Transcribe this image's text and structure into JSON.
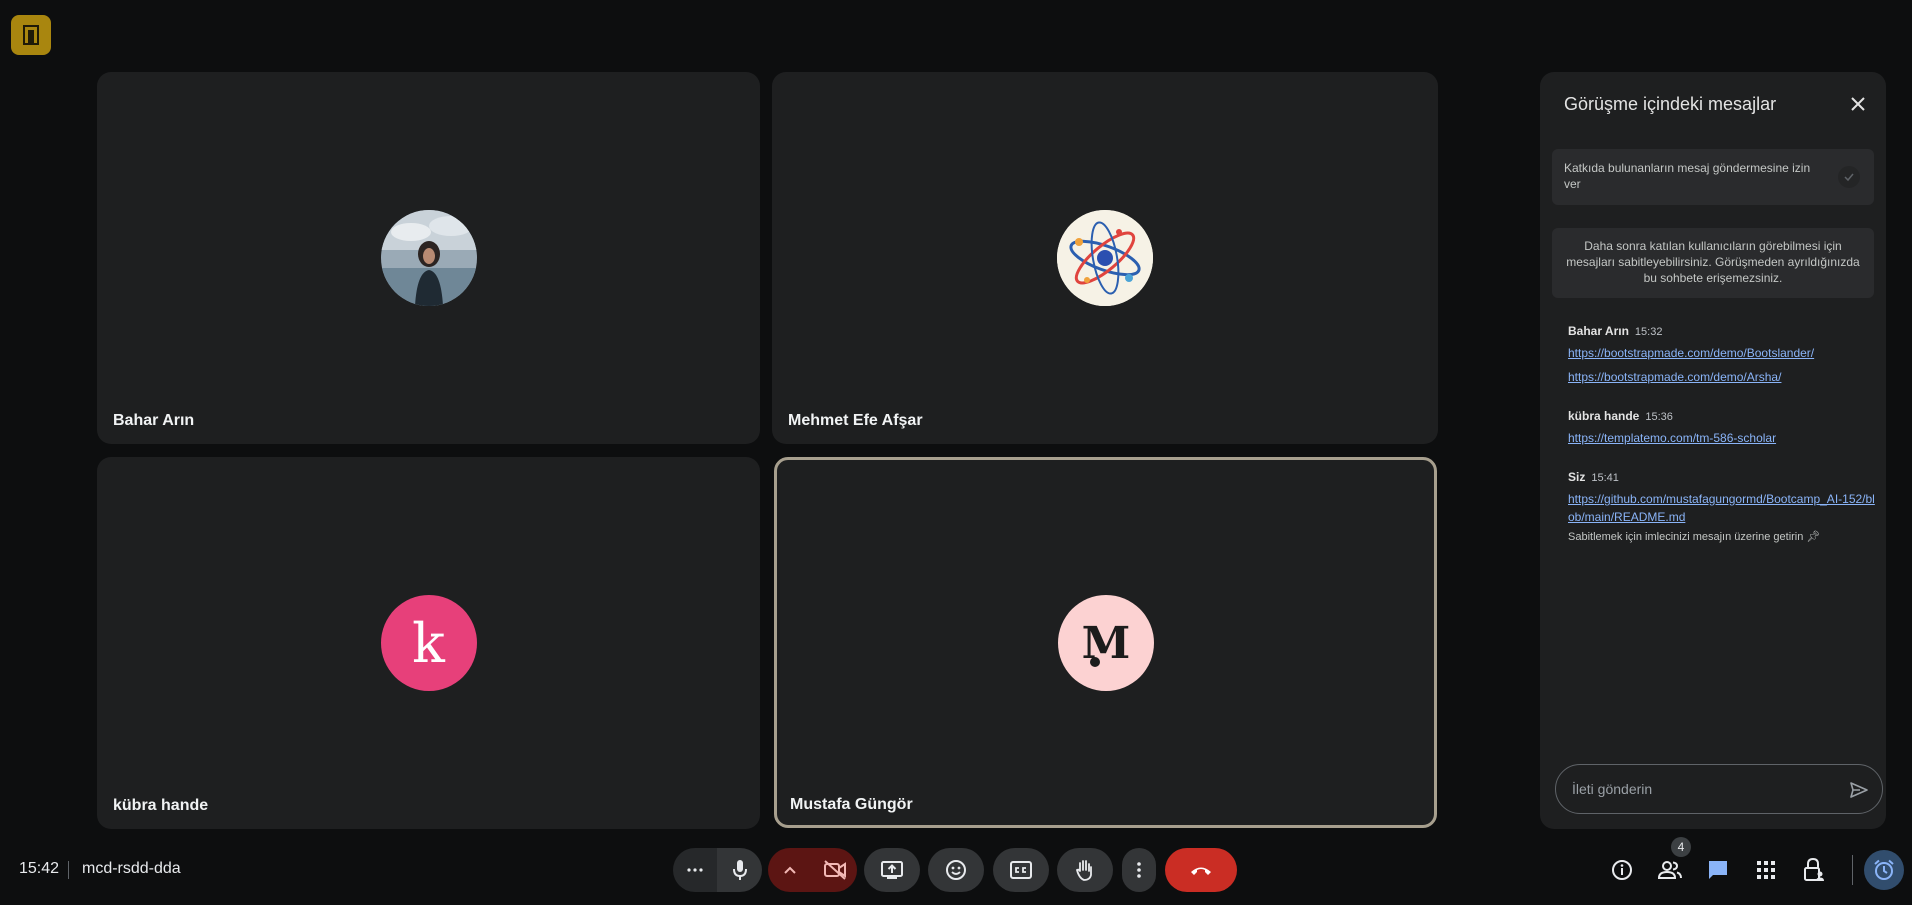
{
  "participants": [
    {
      "name": "Bahar Arın"
    },
    {
      "name": "Mehmet Efe Afşar"
    },
    {
      "name": "kübra hande",
      "initial": "k"
    },
    {
      "name": "Mustafa Güngör",
      "initial": "M"
    }
  ],
  "panel": {
    "title": "Görüşme içindeki mesajlar",
    "toggle_label": "Katkıda bulunanların mesaj göndermesine izin ver",
    "info": "Daha sonra katılan kullanıcıların görebilmesi için mesajları sabitleyebilirsiniz. Görüşmeden ayrıldığınızda bu sohbete erişemezsiniz.",
    "messages": [
      {
        "sender": "Bahar Arın",
        "time": "15:32",
        "links": [
          "https://bootstrapmade.com/demo/Bootslander/",
          "https://bootstrapmade.com/demo/Arsha/"
        ]
      },
      {
        "sender": "kübra hande",
        "time": "15:36",
        "links": [
          "https://templatemo.com/tm-586-scholar"
        ]
      },
      {
        "sender": "Siz",
        "time": "15:41",
        "links": [
          "https://github.com/mustafagungormd/Bootcamp_AI-152/blob/main/README.md"
        ],
        "hint": "Sabitlemek için imlecinizi mesajın üzerine getirin"
      }
    ],
    "compose_placeholder": "İleti gönderin"
  },
  "bottom_bar": {
    "time": "15:42",
    "meeting_code": "mcd-rsdd-dda",
    "people_count": "4"
  },
  "colors": {
    "end_call": "#ca2d24",
    "camera_off": "#5c1513",
    "active_tile_border": "#a79f8e",
    "link": "#8ab4f8"
  }
}
